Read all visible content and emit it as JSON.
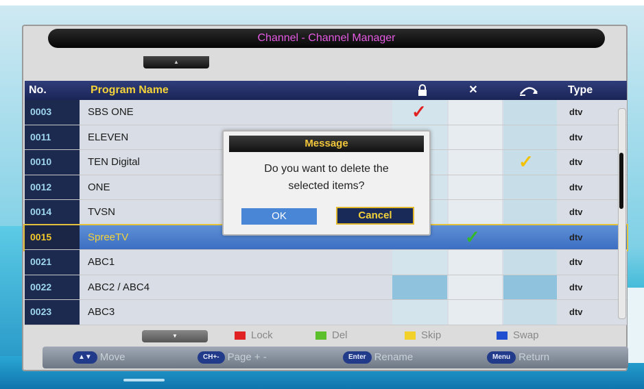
{
  "window": {
    "title": "Channel - Channel Manager"
  },
  "scroll": {
    "up_glyph": "▲",
    "down_glyph": "▼"
  },
  "table": {
    "headers": {
      "no": "No.",
      "name": "Program Name",
      "lock_icon": "🔒",
      "del_icon": "✕",
      "skip_icon": "⤼",
      "type": "Type"
    },
    "rows": [
      {
        "no": "0003",
        "name": "SBS ONE",
        "type": "dtv",
        "lock": true,
        "del": false,
        "skip": false
      },
      {
        "no": "0011",
        "name": "ELEVEN",
        "type": "dtv",
        "lock": false,
        "del": false,
        "skip": false
      },
      {
        "no": "0010",
        "name": "TEN Digital",
        "type": "dtv",
        "lock": false,
        "del": false,
        "skip": true
      },
      {
        "no": "0012",
        "name": "ONE",
        "type": "dtv",
        "lock": false,
        "del": false,
        "skip": false
      },
      {
        "no": "0014",
        "name": "TVSN",
        "type": "dtv",
        "lock": false,
        "del": false,
        "skip": false
      },
      {
        "no": "0015",
        "name": "SpreeTV",
        "type": "dtv",
        "lock": false,
        "del": true,
        "skip": false,
        "selected": true
      },
      {
        "no": "0021",
        "name": "ABC1",
        "type": "dtv",
        "lock": false,
        "del": false,
        "skip": false
      },
      {
        "no": "0022",
        "name": "ABC2 / ABC4",
        "type": "dtv",
        "lock": false,
        "del": false,
        "skip": false
      },
      {
        "no": "0023",
        "name": "ABC3",
        "type": "dtv",
        "lock": false,
        "del": false,
        "skip": false
      }
    ],
    "check_glyph": "✓"
  },
  "legend": [
    {
      "label": "Lock",
      "color": "#e02222"
    },
    {
      "label": "Del",
      "color": "#5cc02c"
    },
    {
      "label": "Skip",
      "color": "#f2d22a"
    },
    {
      "label": "Swap",
      "color": "#1f4fd0"
    }
  ],
  "footer": [
    {
      "key": "▲▼",
      "label": "Move"
    },
    {
      "key": "CH+-",
      "label": "Page + -"
    },
    {
      "key": "Enter",
      "label": "Rename"
    },
    {
      "key": "Menu",
      "label": "Return"
    }
  ],
  "dialog": {
    "title": "Message",
    "line1": "Do you want to delete the",
    "line2": "selected items?",
    "ok_label": "OK",
    "cancel_label": "Cancel"
  }
}
